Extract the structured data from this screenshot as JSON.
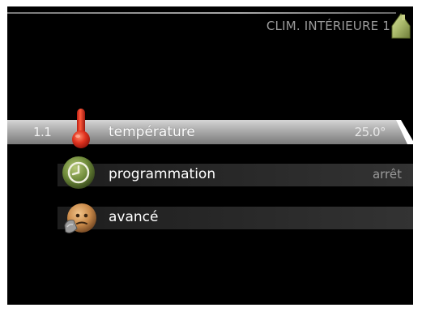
{
  "header": {
    "title": "CLIM. INTÉRIEURE 1",
    "icon": "house-icon"
  },
  "menu": {
    "items": [
      {
        "number": "1.1",
        "label": "température",
        "value": "25.0°",
        "icon": "thermometer-icon",
        "selected": true
      },
      {
        "number": "",
        "label": "programmation",
        "value": "arrêt",
        "icon": "clock-icon",
        "selected": false
      },
      {
        "number": "",
        "label": "avancé",
        "value": "",
        "icon": "advanced-settings-icon",
        "selected": false
      }
    ]
  },
  "colors": {
    "screen_background": "#000000",
    "selected_row": "#bdbdbd",
    "text": "#ffffff",
    "muted_text": "#9a9a9a",
    "thermometer_red": "#d8261c",
    "clock_green": "#6e8a3a",
    "house_green": "#a8b86a"
  }
}
